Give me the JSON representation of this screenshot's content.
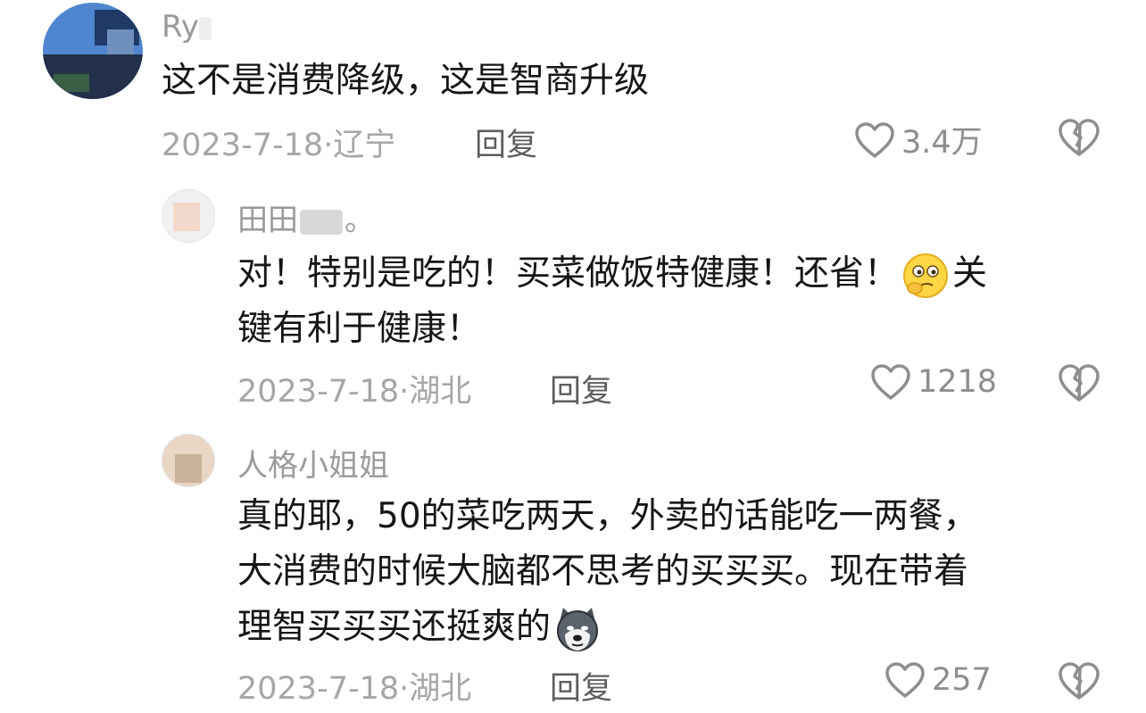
{
  "comments": [
    {
      "username": "Ry",
      "text": "这不是消费降级，这是智商升级",
      "date": "2023-7-18",
      "location": "辽宁",
      "reply_label": "回复",
      "likes": "3.4万"
    },
    {
      "username": "田田",
      "username_suffix": "。",
      "text_a": "对！特别是吃的！买菜做饭特健康！还省！",
      "text_b": "关",
      "text_c": "键有利于健康！",
      "emoji": "thinking-face-emoji",
      "date": "2023-7-18",
      "location": "湖北",
      "reply_label": "回复",
      "likes": "1218"
    },
    {
      "username": "人格小姐姐",
      "text_line1": "真的耶，50的菜吃两天，外卖的话能吃一两餐，",
      "text_line2": "大消费的时候大脑都不思考的买买买。现在带着",
      "text_line3": "理智买买买还挺爽的",
      "emoji": "husky-dog-emoji",
      "date": "2023-7-18",
      "location": "湖北",
      "reply_label": "回复",
      "likes": "257"
    }
  ],
  "icons": {
    "like": "heart-outline-icon",
    "dislike": "broken-heart-icon"
  },
  "colors": {
    "text": "#161616",
    "muted": "#a6a6a6",
    "icon": "#8e8e8e"
  }
}
